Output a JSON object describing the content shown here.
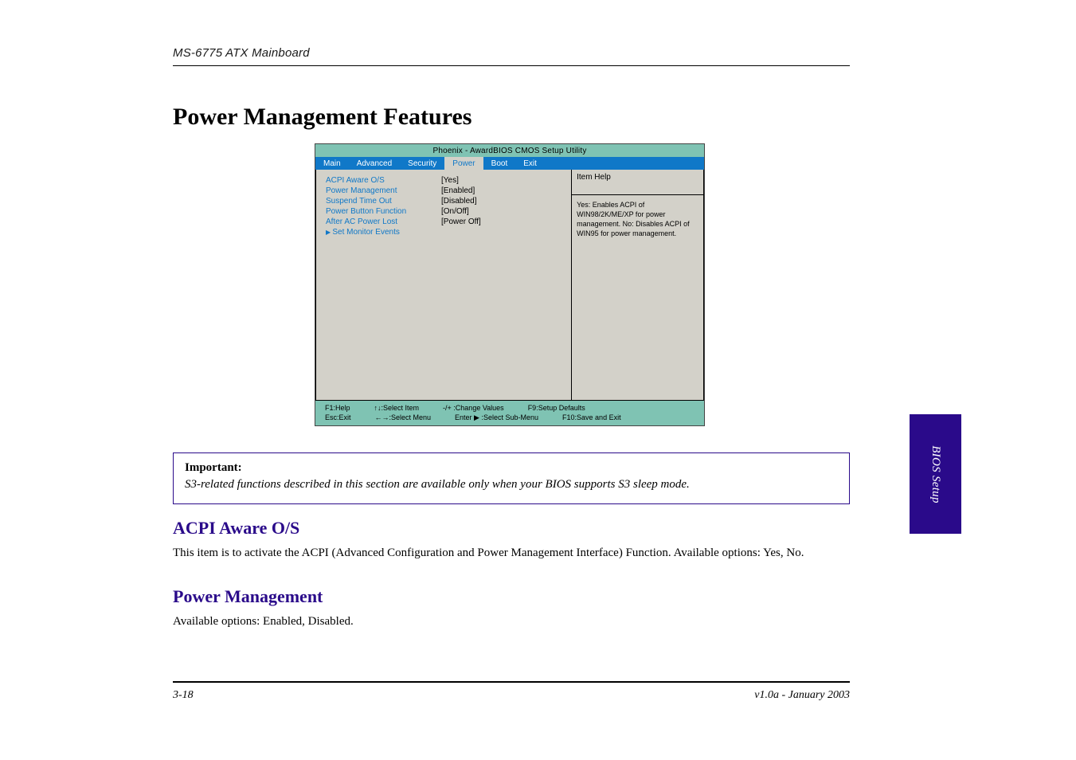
{
  "header": {
    "title": "MS-6775 ATX Mainboard"
  },
  "section_heading": "Power Management Features",
  "bios": {
    "title": "Phoenix - AwardBIOS CMOS Setup Utility",
    "tabs": [
      "Main",
      "Advanced",
      "Security",
      "Power",
      "Boot",
      "Exit"
    ],
    "active_tab_index": 3,
    "left_rows": [
      {
        "label": "ACPI Aware O/S",
        "value": "[Yes]"
      },
      {
        "label": "Power Management",
        "value": "[Enabled]"
      },
      {
        "label": "Suspend Time Out",
        "value": "[Disabled]"
      },
      {
        "label": "Power Button Function",
        "value": "[On/Off]"
      },
      {
        "label": "After AC Power Lost",
        "value": "[Power Off]"
      }
    ],
    "submenu_label": "Set Monitor Events",
    "right_header": "Item Help",
    "right_help": "Yes: Enables ACPI of WIN98/2K/ME/XP for power management. No: Disables ACPI of WIN95 for power management.",
    "footer": {
      "row1": [
        "F1:Help",
        "↑↓:Select Item",
        "-/+ :Change Values",
        "F9:Setup Defaults"
      ],
      "row2": [
        "Esc:Exit",
        "←→:Select Menu",
        "Enter ▶ :Select Sub-Menu",
        "F10:Save and Exit"
      ]
    }
  },
  "important": {
    "label": "Important:",
    "text": "S3-related functions described in this section are available only when your BIOS supports S3 sleep mode."
  },
  "field1": {
    "heading": "ACPI Aware O/S",
    "desc": "This item is to activate the ACPI (Advanced Configuration and Power Management Interface) Function. Available options: Yes, No."
  },
  "field2": {
    "heading": "Power Management",
    "desc": "Available options: Enabled, Disabled."
  },
  "footer": {
    "left": "3-18",
    "right": "v1.0a - January 2003"
  },
  "side_tab": "BIOS Setup"
}
